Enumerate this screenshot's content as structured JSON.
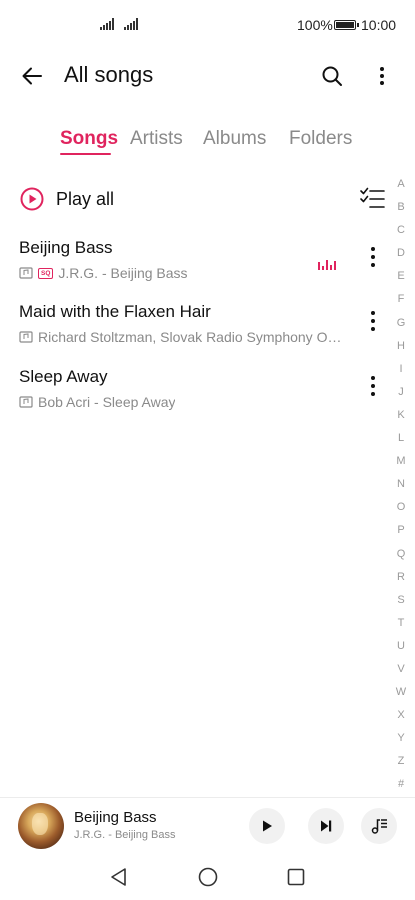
{
  "status_bar": {
    "battery_percent": "100%",
    "time": "10:00"
  },
  "header": {
    "title": "All songs",
    "icons": [
      "back-arrow-icon",
      "search-icon",
      "more-vertical-icon"
    ]
  },
  "tabs": [
    {
      "label": "Songs",
      "active": true
    },
    {
      "label": "Artists",
      "active": false
    },
    {
      "label": "Albums",
      "active": false
    },
    {
      "label": "Folders",
      "active": false
    }
  ],
  "play_all": {
    "label": "Play all"
  },
  "songs": [
    {
      "title": "Beijing Bass",
      "subtitle": "J.R.G. - Beijing Bass",
      "sq_badge": "SQ",
      "playing": true
    },
    {
      "title": "Maid with the Flaxen Hair",
      "subtitle": "Richard Stoltzman, Slovak Radio Symphony O…",
      "playing": false
    },
    {
      "title": "Sleep Away",
      "subtitle": "Bob Acri - Sleep Away",
      "playing": false
    }
  ],
  "alphabet_index": [
    "A",
    "B",
    "C",
    "D",
    "E",
    "F",
    "G",
    "H",
    "I",
    "J",
    "K",
    "L",
    "M",
    "N",
    "O",
    "P",
    "Q",
    "R",
    "S",
    "T",
    "U",
    "V",
    "W",
    "X",
    "Y",
    "Z",
    "#"
  ],
  "now_playing": {
    "title": "Beijing Bass",
    "subtitle": "J.R.G. - Beijing Bass"
  },
  "colors": {
    "accent": "#e0245e",
    "secondary_text": "#8a8a8a",
    "primary_text": "#111111"
  }
}
